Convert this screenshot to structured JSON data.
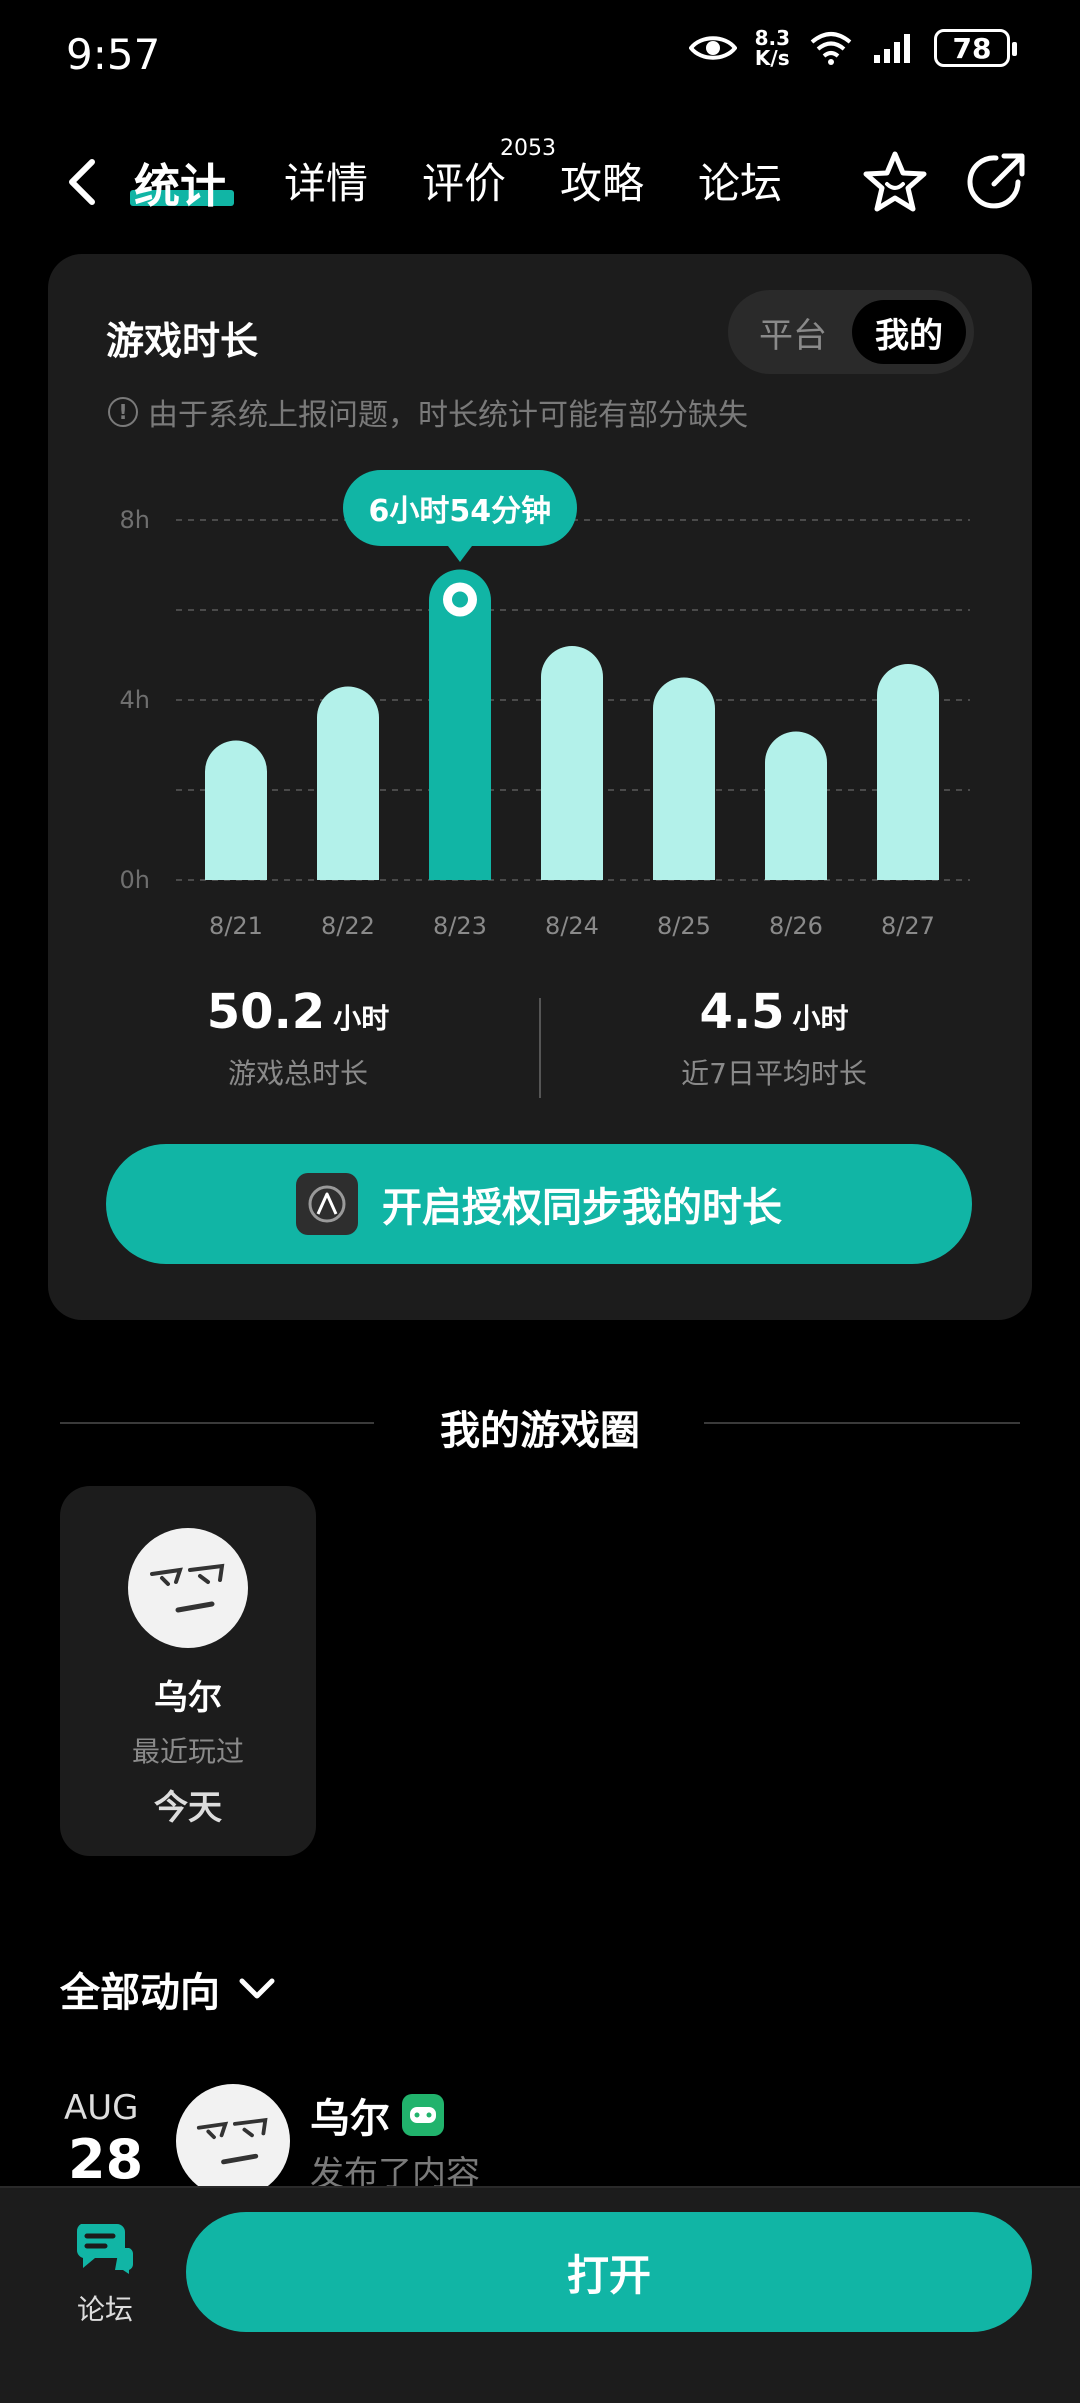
{
  "status_bar": {
    "time": "9:57",
    "net_speed_value": "8.3",
    "net_speed_unit": "K/s",
    "battery": "78"
  },
  "nav": {
    "tabs": [
      {
        "label": "统计",
        "active": true
      },
      {
        "label": "详情"
      },
      {
        "label": "评价",
        "badge": "2053"
      },
      {
        "label": "攻略"
      },
      {
        "label": "论坛"
      }
    ],
    "icons": [
      "back-arrow-icon",
      "star-icon",
      "share-icon"
    ]
  },
  "playtime": {
    "title": "游戏时长",
    "segments": {
      "platform": "平台",
      "mine": "我的",
      "selected": "mine"
    },
    "notice": "由于系统上报问题，时长统计可能有部分缺失",
    "tooltip": "6小时54分钟",
    "total_value": "50.2",
    "total_unit": "小时",
    "total_label": "游戏总时长",
    "avg_value": "4.5",
    "avg_unit": "小时",
    "avg_label": "近7日平均时长",
    "sync_button": "开启授权同步我的时长"
  },
  "chart_data": {
    "type": "bar",
    "categories": [
      "8/21",
      "8/22",
      "8/23",
      "8/24",
      "8/25",
      "8/26",
      "8/27"
    ],
    "values": [
      3.1,
      4.3,
      6.9,
      5.2,
      4.5,
      3.3,
      4.8
    ],
    "y_ticks": [
      "0h",
      "4h",
      "8h"
    ],
    "ylim": [
      0,
      8
    ],
    "highlighted_index": 2,
    "grid": true,
    "colors": {
      "bar": "#b3f1ea",
      "highlight": "#11b5a5"
    }
  },
  "circle": {
    "section_title": "我的游戏圈",
    "name": "乌尔",
    "sub": "最近玩过",
    "when": "今天"
  },
  "feed": {
    "filter_label": "全部动向",
    "month": "AUG",
    "day": "28",
    "user": "乌尔",
    "action": "发布了内容"
  },
  "bottom": {
    "forum_label": "论坛",
    "open_button": "打开"
  },
  "colors": {
    "accent": "#11b5a5",
    "card": "#1c1c1c",
    "background": "#000000"
  }
}
